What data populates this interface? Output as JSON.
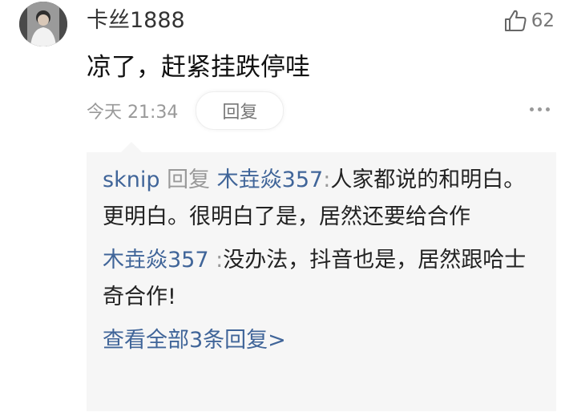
{
  "comment": {
    "username": "卡丝1888",
    "like_count": "62",
    "text": "凉了，赶紧挂跌停哇",
    "timestamp": "今天 21:34",
    "reply_label": "回复"
  },
  "replies": {
    "items": [
      {
        "author": "sknip",
        "reply_word": "回复",
        "target": "木垚焱357",
        "separator": ":",
        "text": "人家都说的和明白。更明白。很明白了是，居然还要给合作"
      },
      {
        "author": "木垚焱357",
        "separator": ":",
        "text": "没办法，抖音也是，居然跟哈士奇合作!"
      }
    ],
    "view_all": "查看全部3条回复>"
  },
  "icons": {
    "like": "thumbs-up-icon",
    "more": "more-dots-icon"
  },
  "colors": {
    "link_blue": "#406599",
    "meta_gray": "#999999",
    "reply_bg": "#f6f6f6"
  }
}
